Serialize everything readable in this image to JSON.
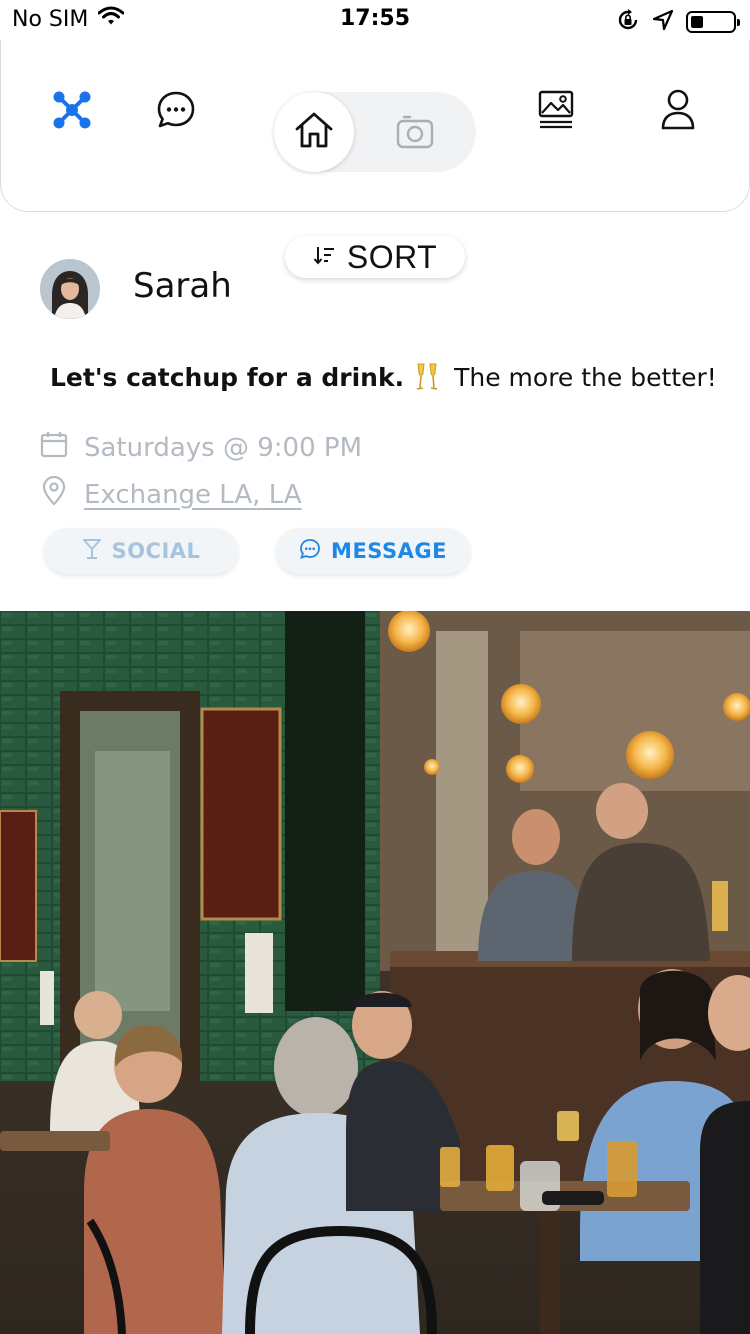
{
  "status_bar": {
    "carrier": "No SIM",
    "time": "17:55",
    "battery_level": 0.3
  },
  "nav": {
    "icons": [
      "network-icon",
      "chat-bubble-icon",
      "home-icon",
      "camera-icon",
      "gallery-icon",
      "profile-icon"
    ],
    "active_color": "#1a73e8",
    "active_tab": "home"
  },
  "sort": {
    "label": "SORT"
  },
  "post": {
    "user_name": "Sarah",
    "text_bold": "Let's catchup for a drink.",
    "text_rest": "The more the better!",
    "emoji_icon": "champagne-glasses-icon",
    "schedule": "Saturdays @ 9:00 PM",
    "location": "Exchange LA, LA",
    "category_label": "SOCIAL",
    "message_label": "MESSAGE"
  },
  "colors": {
    "accent": "#1e88e5",
    "muted": "#b3bac2",
    "pill_bg": "#f1f5f8"
  }
}
